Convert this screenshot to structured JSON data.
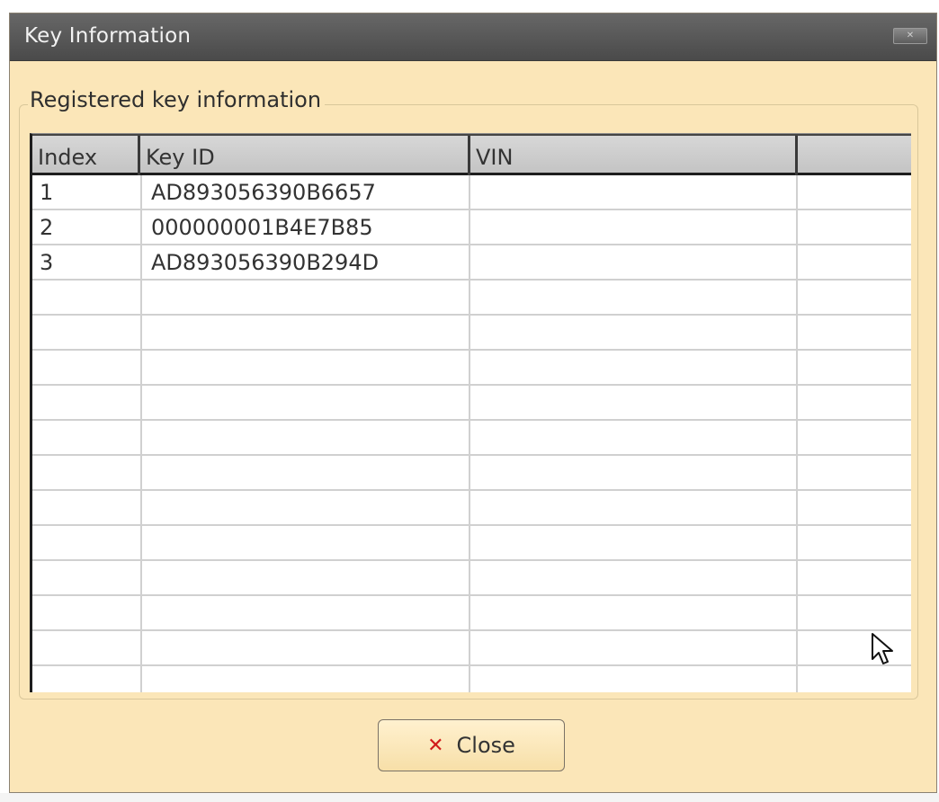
{
  "window": {
    "title": "Key Information",
    "close_icon": "close-x-icon"
  },
  "group": {
    "label": "Registered key information"
  },
  "table": {
    "columns": [
      "Index",
      "Key ID",
      "VIN",
      ""
    ],
    "rows": [
      {
        "index": "1",
        "key_id": "AD893056390B6657",
        "vin": ""
      },
      {
        "index": "2",
        "key_id": "000000001B4E7B85",
        "vin": ""
      },
      {
        "index": "3",
        "key_id": "AD893056390B294D",
        "vin": ""
      }
    ]
  },
  "footer": {
    "close_label": "Close",
    "close_icon": "red-x-icon"
  },
  "colors": {
    "window_bg": "#fbe6b8",
    "titlebar": "#555555",
    "close_icon": "#d11a1a"
  }
}
